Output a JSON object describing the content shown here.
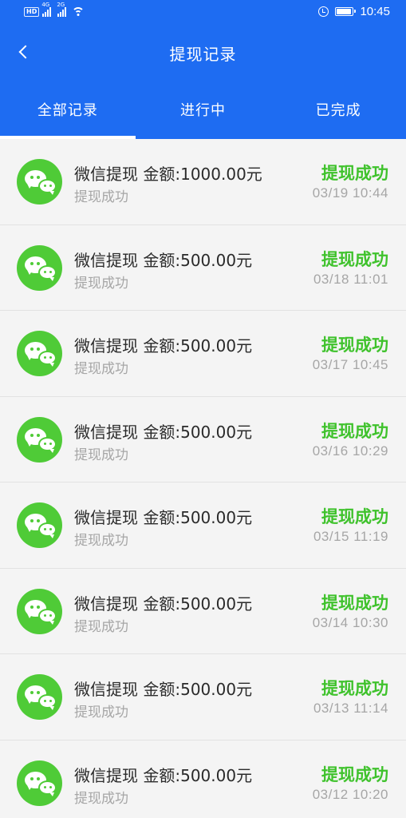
{
  "theme": {
    "header_bg": "#1e6cf2",
    "success_green": "#3fc22c",
    "wechat_green": "#4fcb37",
    "page_bg": "#f4f4f4"
  },
  "status_bar": {
    "left_chip": "HD",
    "left_chip_2": "",
    "sim1_network": "4G",
    "sim2_network": "2G",
    "icons": [
      "alarm-icon",
      "battery-icon",
      "wifi-icon",
      "signal-icon"
    ],
    "battery_level": 0.9,
    "time": "10:45"
  },
  "navbar": {
    "back_icon": "chevron-left-icon",
    "title": "提现记录"
  },
  "tabs": [
    {
      "label": "全部记录",
      "active": true
    },
    {
      "label": "进行中",
      "active": false
    },
    {
      "label": "已完成",
      "active": false
    }
  ],
  "records": [
    {
      "icon": "wechat-icon",
      "title": "微信提现 金额:1000.00元",
      "subtitle": "提现成功",
      "status": "提现成功",
      "time": "03/19 10:44"
    },
    {
      "icon": "wechat-icon",
      "title": "微信提现 金额:500.00元",
      "subtitle": "提现成功",
      "status": "提现成功",
      "time": "03/18 11:01"
    },
    {
      "icon": "wechat-icon",
      "title": "微信提现 金额:500.00元",
      "subtitle": "提现成功",
      "status": "提现成功",
      "time": "03/17 10:45"
    },
    {
      "icon": "wechat-icon",
      "title": "微信提现 金额:500.00元",
      "subtitle": "提现成功",
      "status": "提现成功",
      "time": "03/16 10:29"
    },
    {
      "icon": "wechat-icon",
      "title": "微信提现 金额:500.00元",
      "subtitle": "提现成功",
      "status": "提现成功",
      "time": "03/15 11:19"
    },
    {
      "icon": "wechat-icon",
      "title": "微信提现 金额:500.00元",
      "subtitle": "提现成功",
      "status": "提现成功",
      "time": "03/14 10:30"
    },
    {
      "icon": "wechat-icon",
      "title": "微信提现 金额:500.00元",
      "subtitle": "提现成功",
      "status": "提现成功",
      "time": "03/13 11:14"
    },
    {
      "icon": "wechat-icon",
      "title": "微信提现 金额:500.00元",
      "subtitle": "提现成功",
      "status": "提现成功",
      "time": "03/12 10:20"
    }
  ]
}
